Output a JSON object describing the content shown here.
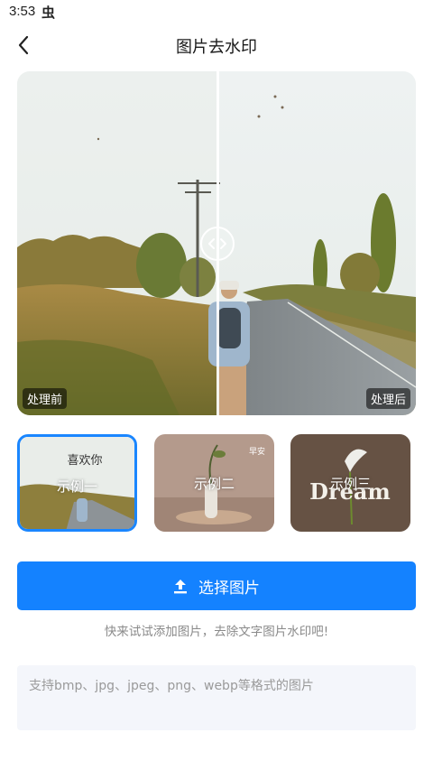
{
  "status_bar": {
    "time": "3:53",
    "app_icon": "虫"
  },
  "header": {
    "title": "图片去水印",
    "back_icon": "chevron-left-icon"
  },
  "compare": {
    "before_label": "处理前",
    "after_label": "处理后",
    "handle_icon": "left-right-arrows-icon"
  },
  "examples": [
    {
      "label": "示例一",
      "selected": true,
      "watermark": "喜欢你"
    },
    {
      "label": "示例二",
      "selected": false,
      "watermark": "早安"
    },
    {
      "label": "示例三",
      "selected": false,
      "watermark": "Dream"
    }
  ],
  "actions": {
    "select_button_label": "选择图片",
    "upload_icon": "upload-icon"
  },
  "hint": "快来试试添加图片，去除文字图片水印吧!",
  "format_note": "支持bmp、jpg、jpeg、png、webp等格式的图片",
  "colors": {
    "accent": "#1482ff",
    "selected_border": "#1a86ff"
  }
}
